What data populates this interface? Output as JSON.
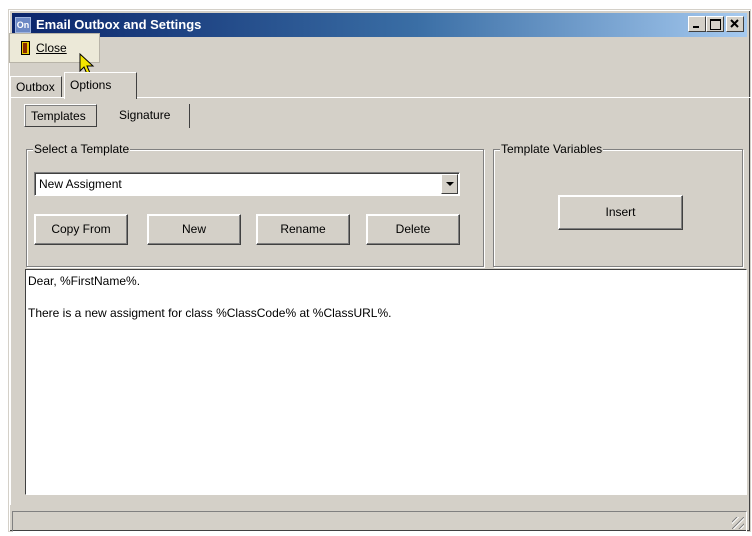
{
  "window": {
    "title": "Email Outbox and Settings",
    "app_icon_text": "On",
    "caption_buttons": [
      "minimize",
      "maximize",
      "close"
    ]
  },
  "toolbar": {
    "close_label": "Close"
  },
  "tabs": {
    "outbox": "Outbox",
    "options": "Options",
    "active": "Options"
  },
  "subtabs": {
    "templates": "Templates",
    "signature": "Signature",
    "active": "Templates"
  },
  "select_template": {
    "group_label": "Select a Template",
    "selected": "New Assigment",
    "buttons": {
      "copy_from": "Copy From",
      "new": "New",
      "rename": "Rename",
      "delete": "Delete"
    }
  },
  "template_variables": {
    "group_label": "Template Variables",
    "insert_label": "Insert"
  },
  "editor": {
    "line1": "Dear, %FirstName%.",
    "line2": "There is a new assigment for class %ClassCode% at %ClassURL%."
  },
  "colors": {
    "window_face": "#d4d0c8",
    "titlebar_start": "#0a246a",
    "titlebar_end": "#a6caf0"
  }
}
